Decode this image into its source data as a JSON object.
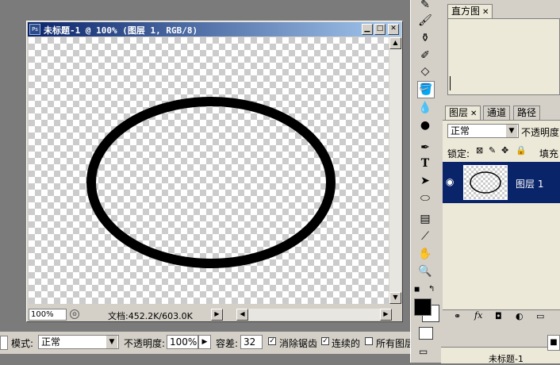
{
  "document": {
    "title": "未标题-1 @ 100% (图层 1, RGB/8)",
    "ps_badge": "Ps",
    "zoom": "100%",
    "info": "文档:452.2K/603.0K"
  },
  "options_bar": {
    "mode_label": "模式:",
    "mode_value": "正常",
    "opacity_label": "不透明度:",
    "opacity_value": "100%",
    "tolerance_label": "容差:",
    "tolerance_value": "32",
    "antialias_label": "消除锯齿",
    "contiguous_label": "连续的",
    "all_layers_label": "所有图层"
  },
  "histogram_panel": {
    "tab": "直方图"
  },
  "layers_panel": {
    "tabs": [
      "图层",
      "通道",
      "路径"
    ],
    "blend_mode": "正常",
    "opacity_label": "不透明度",
    "lock_label": "锁定:",
    "fill_label": "填充",
    "layer_name": "图层 1",
    "bottom_layer_name": "未标题-1"
  },
  "colors": {
    "selection": "#0a246a",
    "title_start": "#0a246a",
    "title_end": "#a6caf0"
  }
}
